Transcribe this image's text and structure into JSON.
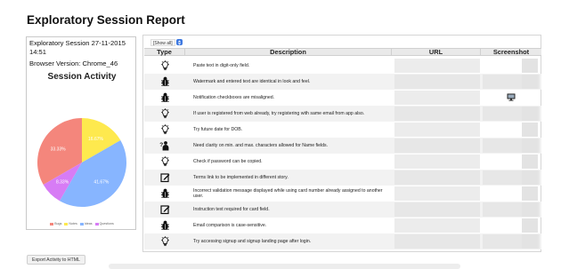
{
  "report": {
    "title": "Exploratory Session Report",
    "session_label": "Exploratory Session 27-11-2015",
    "session_time": "14:51",
    "browser_label": "Browser Version: Chrome_46"
  },
  "chart_data": {
    "type": "pie",
    "title": "Session Activity",
    "slices": [
      {
        "name": "Bugs",
        "value": 33.33,
        "label": "33.33%",
        "color": "#f4867c"
      },
      {
        "name": "Notes",
        "value": 16.67,
        "label": "16.67%",
        "color": "#fee94e"
      },
      {
        "name": "Ideas",
        "value": 41.67,
        "label": "41.67%",
        "color": "#87b5ff"
      },
      {
        "name": "Questions",
        "value": 8.33,
        "label": "8.33%",
        "color": "#d77cf5"
      }
    ],
    "legend_position": "bottom"
  },
  "toolbar": {
    "filter_value": "[Show all]"
  },
  "table": {
    "headers": [
      "Type",
      "Description",
      "URL",
      "Screenshot"
    ],
    "rows": [
      {
        "type_icon": "idea-icon",
        "description": "Paste text in digit-only field.",
        "screenshot": false
      },
      {
        "type_icon": "bug-icon",
        "description": "Watermark and entered text are identical in look and feel.",
        "screenshot": false
      },
      {
        "type_icon": "bug-icon",
        "description": "Notification checkboxes are misaligned.",
        "screenshot": true
      },
      {
        "type_icon": "idea-icon",
        "description": "If user is registered from web already, try registering with same email from app also.",
        "screenshot": false
      },
      {
        "type_icon": "idea-icon",
        "description": "Try future date for DOB.",
        "screenshot": false
      },
      {
        "type_icon": "question-icon",
        "description": "Need clarity on min. and max. characters allowed for Name fields.",
        "screenshot": false
      },
      {
        "type_icon": "idea-icon",
        "description": "Check if password can be copied.",
        "screenshot": false
      },
      {
        "type_icon": "note-icon",
        "description": "Terms link to be implemented in different story.",
        "screenshot": false
      },
      {
        "type_icon": "bug-icon",
        "description": "Incorrect validation message displayed while using card number already assigned to another user.",
        "screenshot": false
      },
      {
        "type_icon": "note-icon",
        "description": "Instruction text required for card field.",
        "screenshot": false
      },
      {
        "type_icon": "bug-icon",
        "description": "Email comparison is case-sensitive.",
        "screenshot": false
      },
      {
        "type_icon": "idea-icon",
        "description": "Try accessing signup and signup landing page after login.",
        "screenshot": false
      }
    ]
  },
  "footer": {
    "export_label": "Export Activity to HTML"
  }
}
